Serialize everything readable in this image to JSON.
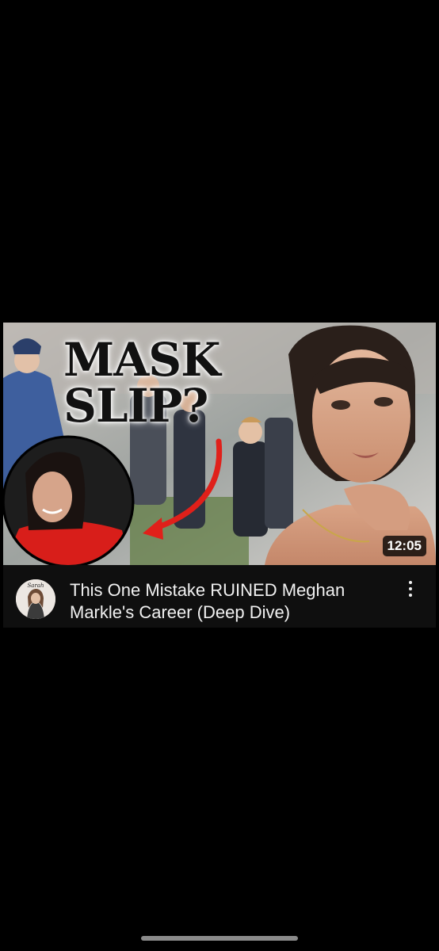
{
  "video": {
    "thumbnail_text_line1": "MASK",
    "thumbnail_text_line2": "SLIP?",
    "duration": "12:05",
    "title": "This One Mistake RUINED Meghan Markle's Career (Deep Dive)",
    "channel_avatar_text": "Sarah",
    "more_icon": "vertical-ellipsis-icon"
  },
  "colors": {
    "background": "#000000",
    "card_background": "#0f0f0f",
    "title_text": "#f1f1f1",
    "arrow_red": "#e0201a",
    "duration_badge": "#000000"
  }
}
